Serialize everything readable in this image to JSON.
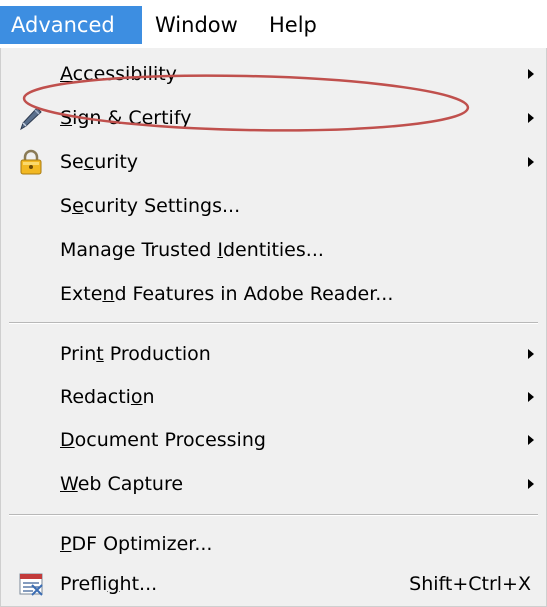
{
  "menubar": {
    "items": [
      {
        "label": "Advanced"
      },
      {
        "label": "Window"
      },
      {
        "label": "Help"
      }
    ]
  },
  "menu": {
    "accessibility": {
      "pre": "",
      "key": "A",
      "post": "ccessibility"
    },
    "sign_certify": {
      "pre": "",
      "key": "S",
      "post": "ign & Certify"
    },
    "security": {
      "pre": "Se",
      "key": "c",
      "post": "urity"
    },
    "security_settings": {
      "pre": "S",
      "key": "e",
      "post": "curity Settings..."
    },
    "manage_trusted": {
      "pre": "Manage Trusted ",
      "key": "I",
      "post": "dentities..."
    },
    "extend_features": {
      "pre": "Exte",
      "key": "n",
      "post": "d Features in Adobe Reader..."
    },
    "print_production": {
      "pre": "Prin",
      "key": "t",
      "post": " Production"
    },
    "redaction": {
      "pre": "Redacti",
      "key": "o",
      "post": "n"
    },
    "document_processing": {
      "pre": "",
      "key": "D",
      "post": "ocument Processing"
    },
    "web_capture": {
      "pre": "",
      "key": "W",
      "post": "eb Capture"
    },
    "pdf_optimizer": {
      "pre": "",
      "key": "P",
      "post": "DF Optimizer..."
    },
    "preflight": {
      "pre": "Prefli",
      "key": "g",
      "post": "ht...",
      "shortcut": "Shift+Ctrl+X"
    }
  },
  "colors": {
    "active_menu_bg": "#3d8ee1",
    "menu_bg": "#f0f0f0",
    "annotation": "#c0504d"
  },
  "icons": [
    "pen-icon",
    "lock-icon",
    "preflight-icon",
    "submenu-arrow-icon"
  ]
}
